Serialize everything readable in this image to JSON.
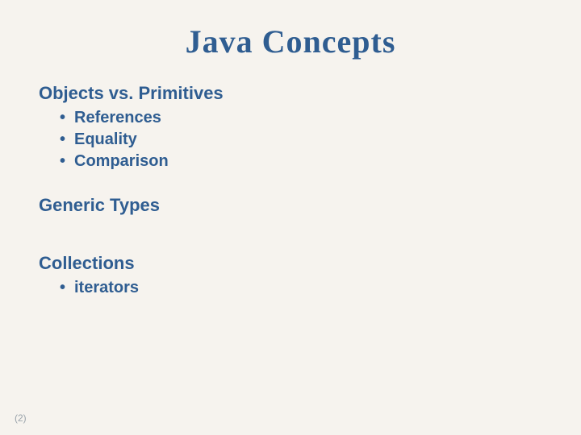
{
  "title": "Java Concepts",
  "sections": [
    {
      "heading": "Objects vs. Primitives",
      "bullets": [
        "References",
        "Equality",
        "Comparison"
      ]
    },
    {
      "heading": "Generic Types",
      "bullets": []
    },
    {
      "heading": "Collections",
      "bullets": [
        "iterators"
      ]
    }
  ],
  "page_number": "(2)"
}
